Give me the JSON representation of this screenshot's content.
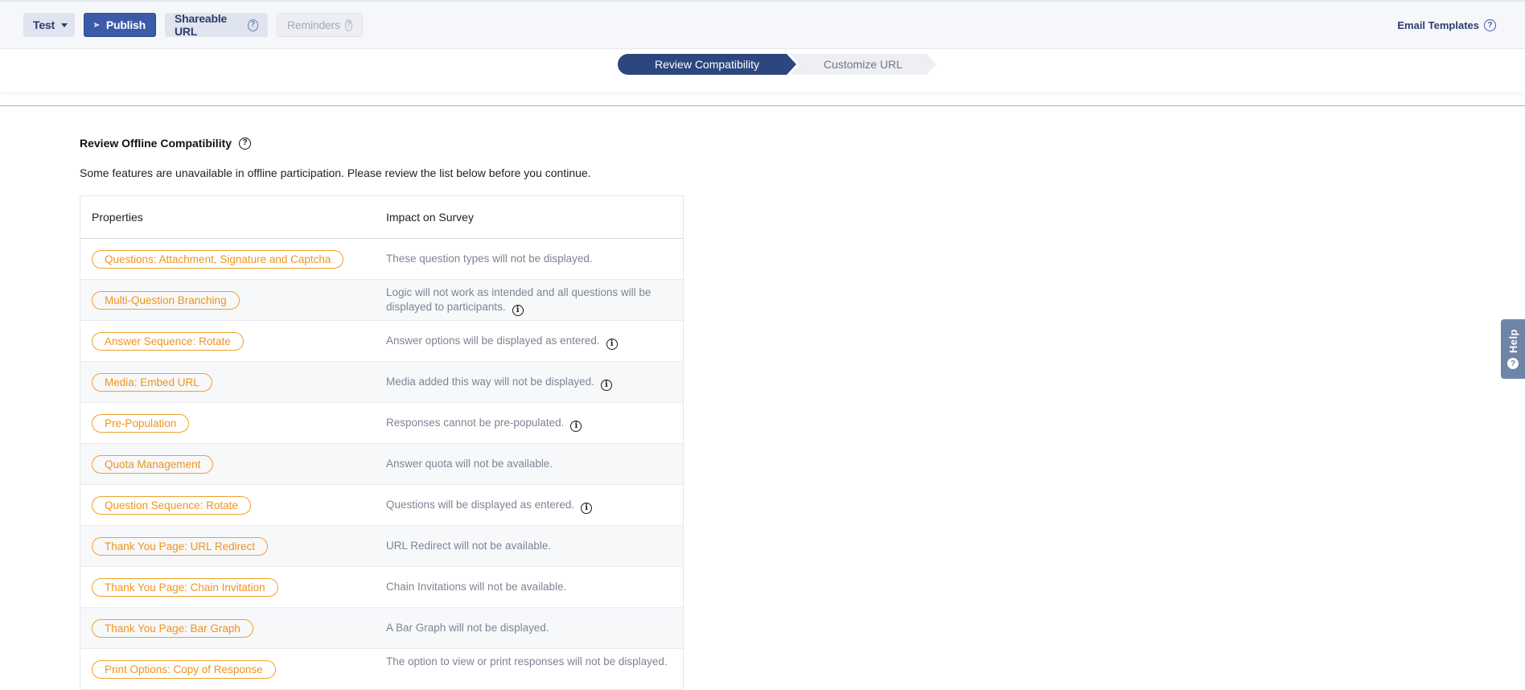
{
  "toolbar": {
    "test_label": "Test",
    "publish_label": "Publish",
    "shareable_label": "Shareable URL",
    "reminders_label": "Reminders",
    "email_templates_label": "Email Templates"
  },
  "steps": {
    "step1": "Review Compatibility",
    "step2": "Customize URL"
  },
  "section": {
    "title": "Review Offline Compatibility",
    "description": "Some features are unavailable in offline participation. Please review the list below before you continue."
  },
  "table": {
    "col_properties": "Properties",
    "col_impact": "Impact on Survey",
    "rows": [
      {
        "property": "Questions: Attachment, Signature and Captcha",
        "impact": "These question types will not be displayed."
      },
      {
        "property": "Multi-Question Branching",
        "impact": "Logic will not work as intended and all questions will be displayed to participants."
      },
      {
        "property": "Answer Sequence: Rotate",
        "impact": "Answer options will be displayed as entered."
      },
      {
        "property": "Media: Embed URL",
        "impact": "Media added this way will not be displayed."
      },
      {
        "property": "Pre-Population",
        "impact": "Responses cannot be pre-populated."
      },
      {
        "property": "Quota Management",
        "impact": "Answer quota will not be available."
      },
      {
        "property": "Question Sequence: Rotate",
        "impact": "Questions will be displayed as entered."
      },
      {
        "property": "Thank You Page: URL Redirect",
        "impact": "URL Redirect will not be available."
      },
      {
        "property": "Thank You Page: Chain Invitation",
        "impact": "Chain Invitations will not be available."
      },
      {
        "property": "Thank You Page: Bar Graph",
        "impact": "A Bar Graph will not be displayed."
      },
      {
        "property": "Print Options: Copy of Response",
        "impact": "The option to view or print responses will not be displayed."
      }
    ]
  },
  "help": {
    "label": "Help"
  },
  "colors": {
    "primary": "#3b5ba9",
    "step_active": "#2e467e",
    "pill_orange": "#f0931e",
    "help_tab": "#6f85a7"
  }
}
